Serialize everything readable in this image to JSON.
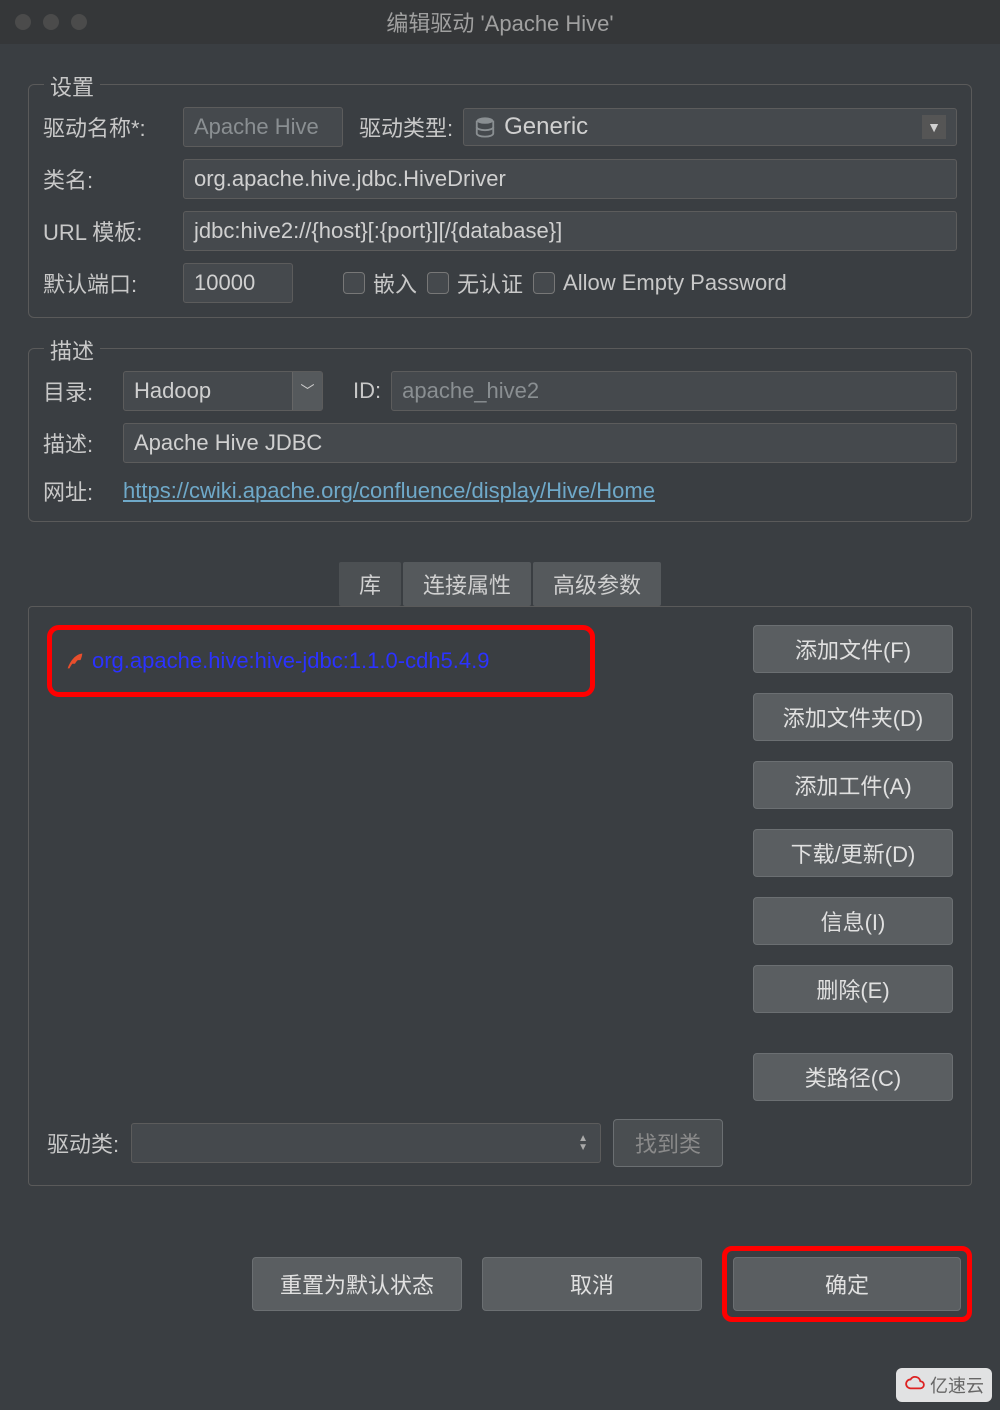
{
  "window": {
    "title": "编辑驱动 'Apache Hive'"
  },
  "settings": {
    "legend": "设置",
    "driverNameLabel": "驱动名称*:",
    "driverName": "Apache Hive",
    "driverTypeLabel": "驱动类型:",
    "driverType": "Generic",
    "classNameLabel": "类名:",
    "className": "org.apache.hive.jdbc.HiveDriver",
    "urlTemplateLabel": "URL 模板:",
    "urlTemplate": "jdbc:hive2://{host}[:{port}][/{database}]",
    "defaultPortLabel": "默认端口:",
    "defaultPort": "10000",
    "embedLabel": "嵌入",
    "noAuthLabel": "无认证",
    "allowEmptyPwdLabel": "Allow Empty Password"
  },
  "desc": {
    "legend": "描述",
    "categoryLabel": "目录:",
    "category": "Hadoop",
    "idLabel": "ID:",
    "id": "apache_hive2",
    "descLabel": "描述:",
    "descValue": "Apache Hive JDBC",
    "urlLabel": "网址:",
    "url": "https://cwiki.apache.org/confluence/display/Hive/Home"
  },
  "tabs": {
    "lib": "库",
    "connProps": "连接属性",
    "advanced": "高级参数"
  },
  "library": {
    "artifact": "org.apache.hive:hive-jdbc:1.1.0-cdh5.4.9",
    "buttons": {
      "addFile": "添加文件(F)",
      "addFolder": "添加文件夹(D)",
      "addArtifact": "添加工件(A)",
      "download": "下载/更新(D)",
      "info": "信息(I)",
      "delete": "删除(E)",
      "classpath": "类路径(C)"
    },
    "driverClassLabel": "驱动类:",
    "findClass": "找到类"
  },
  "footer": {
    "reset": "重置为默认状态",
    "cancel": "取消",
    "ok": "确定"
  },
  "watermark": "亿速云"
}
